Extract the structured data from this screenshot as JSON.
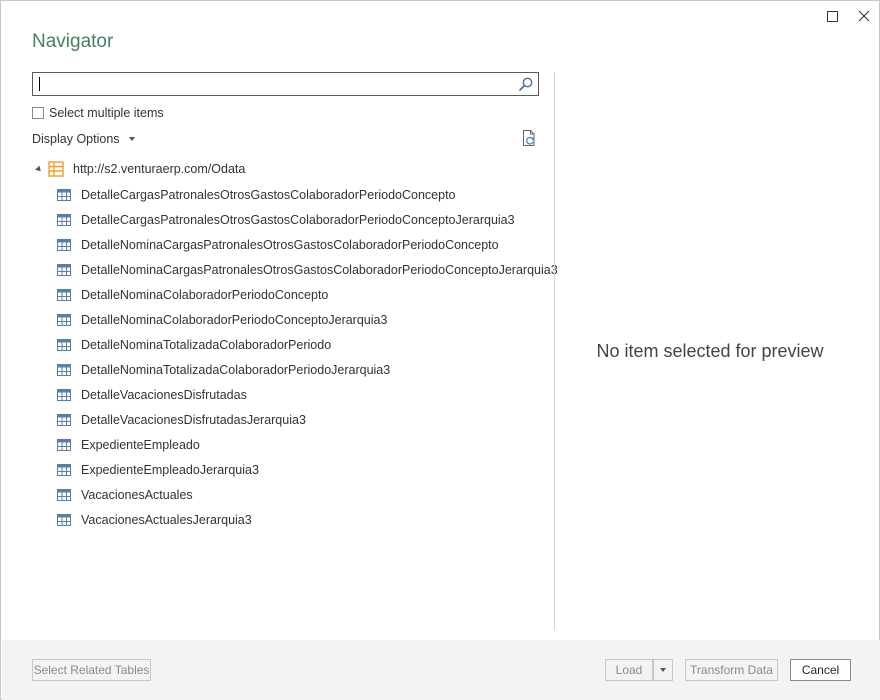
{
  "dialog": {
    "title": "Navigator"
  },
  "search": {
    "value": "",
    "placeholder": ""
  },
  "options": {
    "select_multiple_label": "Select multiple items",
    "select_multiple_checked": false,
    "display_options_label": "Display Options"
  },
  "tree": {
    "root_label": "http://s2.venturaerp.com/Odata",
    "items": [
      {
        "label": "DetalleCargasPatronalesOtrosGastosColaboradorPeriodoConcepto"
      },
      {
        "label": "DetalleCargasPatronalesOtrosGastosColaboradorPeriodoConceptoJerarquia3"
      },
      {
        "label": "DetalleNominaCargasPatronalesOtrosGastosColaboradorPeriodoConcepto"
      },
      {
        "label": "DetalleNominaCargasPatronalesOtrosGastosColaboradorPeriodoConceptoJerarquia3"
      },
      {
        "label": "DetalleNominaColaboradorPeriodoConcepto"
      },
      {
        "label": "DetalleNominaColaboradorPeriodoConceptoJerarquia3"
      },
      {
        "label": "DetalleNominaTotalizadaColaboradorPeriodo"
      },
      {
        "label": "DetalleNominaTotalizadaColaboradorPeriodoJerarquia3"
      },
      {
        "label": "DetalleVacacionesDisfrutadas"
      },
      {
        "label": "DetalleVacacionesDisfrutadasJerarquia3"
      },
      {
        "label": "ExpedienteEmpleado"
      },
      {
        "label": "ExpedienteEmpleadoJerarquia3"
      },
      {
        "label": "VacacionesActuales"
      },
      {
        "label": "VacacionesActualesJerarquia3"
      }
    ]
  },
  "preview": {
    "empty_message": "No item selected for preview"
  },
  "footer": {
    "select_related_label": "Select Related Tables",
    "load_label": "Load",
    "transform_label": "Transform Data",
    "cancel_label": "Cancel"
  },
  "colors": {
    "title": "#4a7f64",
    "table_icon": "#5b7ea8",
    "root_icon": "#f0a030",
    "footer_bg": "#f3f3f3"
  },
  "icons": {
    "maximize": "maximize-icon",
    "close": "close-icon",
    "search": "search-icon",
    "refresh": "refresh-icon",
    "root": "odata-feed-icon",
    "table": "table-icon"
  }
}
